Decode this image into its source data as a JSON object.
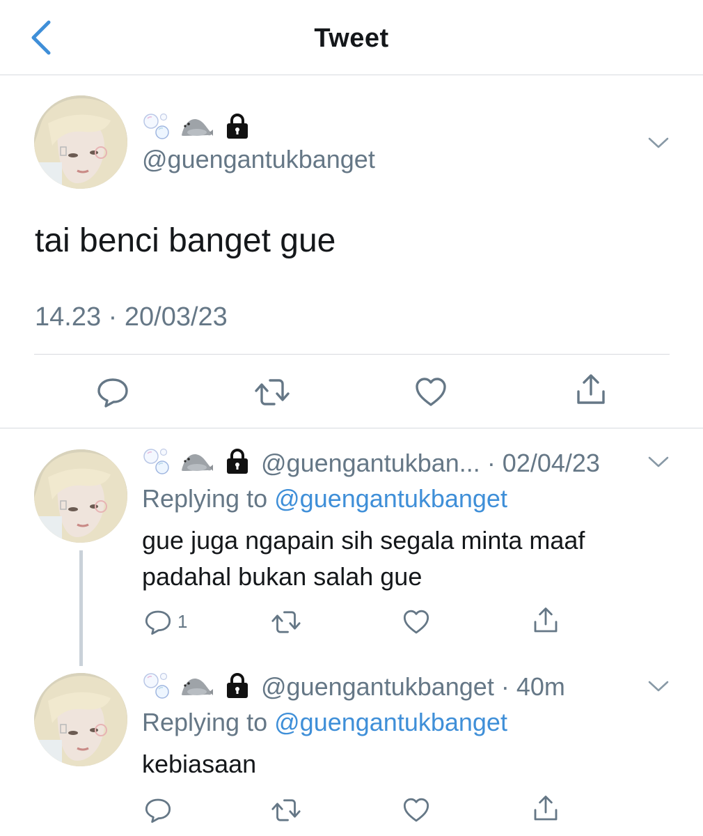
{
  "header": {
    "title": "Tweet",
    "back_icon": "chevron-left-icon"
  },
  "main_tweet": {
    "badges": [
      "bubbles-icon",
      "seal-icon",
      "lock-icon"
    ],
    "handle": "@guengantukbanget",
    "text": "tai benci banget gue",
    "timestamp": "14.23 · 20/03/23",
    "actions": [
      "reply-icon",
      "retweet-icon",
      "like-icon",
      "share-icon"
    ]
  },
  "replies": [
    {
      "handle": "@guengantukban...",
      "time": "· 02/04/23",
      "replying_prefix": "Replying to",
      "replying_handle": "@guengantukbanget",
      "body": "gue juga ngapain sih segala minta maaf padahal bukan salah gue",
      "reply_count": "1"
    },
    {
      "handle": "@guengantukbanget",
      "time": "· 40m",
      "replying_prefix": "Replying to",
      "replying_handle": "@guengantukbanget",
      "body": "kebiasaan",
      "reply_count": ""
    }
  ],
  "colors": {
    "link": "#3f8fd8",
    "muted": "#657786",
    "divider": "#d7dadf",
    "thread_line": "#c9d1d9"
  }
}
